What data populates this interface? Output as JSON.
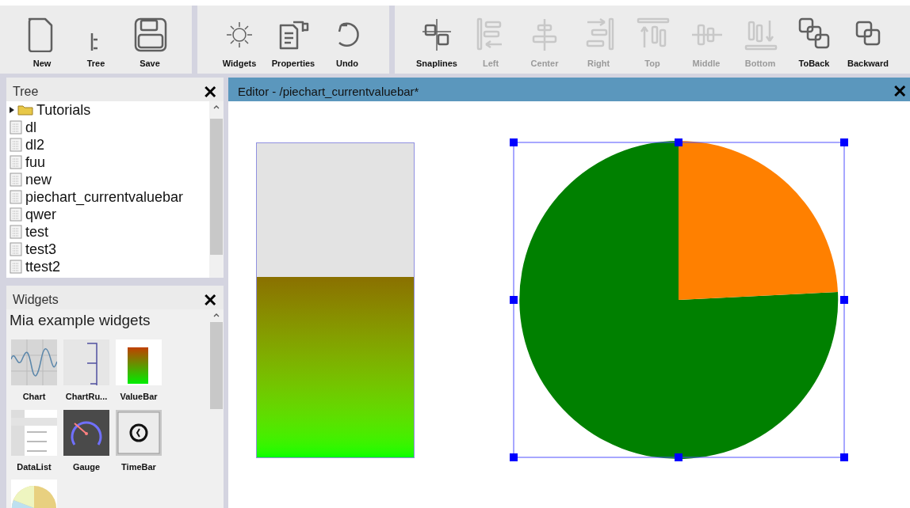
{
  "toolbar": {
    "groups": [
      [
        {
          "label": "New",
          "kind": "new",
          "disabled": false
        },
        {
          "label": "Tree",
          "kind": "tree",
          "disabled": false
        },
        {
          "label": "Save",
          "kind": "save",
          "disabled": false
        }
      ],
      [
        {
          "label": "Widgets",
          "kind": "widgets",
          "disabled": false
        },
        {
          "label": "Properties",
          "kind": "properties",
          "disabled": false
        },
        {
          "label": "Undo",
          "kind": "undo",
          "disabled": false
        }
      ],
      [
        {
          "label": "Snaplines",
          "kind": "snaplines",
          "disabled": false
        },
        {
          "label": "Left",
          "kind": "left",
          "disabled": true
        },
        {
          "label": "Center",
          "kind": "center",
          "disabled": true
        },
        {
          "label": "Right",
          "kind": "right",
          "disabled": true
        },
        {
          "label": "Top",
          "kind": "top",
          "disabled": true
        },
        {
          "label": "Middle",
          "kind": "middle",
          "disabled": true
        },
        {
          "label": "Bottom",
          "kind": "bottom",
          "disabled": true
        },
        {
          "label": "ToBack",
          "kind": "toback",
          "disabled": false
        },
        {
          "label": "Backward",
          "kind": "backward",
          "disabled": false
        }
      ]
    ]
  },
  "tree": {
    "title": "Tree",
    "close": "✕",
    "items": [
      {
        "label": "Tutorials",
        "kind": "folder",
        "expanded": false
      },
      {
        "label": "dl",
        "kind": "file"
      },
      {
        "label": "dl2",
        "kind": "file"
      },
      {
        "label": "fuu",
        "kind": "file"
      },
      {
        "label": "new",
        "kind": "file"
      },
      {
        "label": "piechart_currentvaluebar",
        "kind": "file"
      },
      {
        "label": "qwer",
        "kind": "file"
      },
      {
        "label": "test",
        "kind": "file"
      },
      {
        "label": "test3",
        "kind": "file"
      },
      {
        "label": "ttest2",
        "kind": "file"
      }
    ]
  },
  "widgets": {
    "title": "Widgets",
    "close": "✕",
    "group": "Mia example widgets",
    "items": [
      {
        "label": "Chart",
        "kind": "chart"
      },
      {
        "label": "ChartRu...",
        "kind": "ruler"
      },
      {
        "label": "ValueBar",
        "kind": "valuebar"
      },
      {
        "label": "DataList",
        "kind": "datalist"
      },
      {
        "label": "Gauge",
        "kind": "gauge"
      },
      {
        "label": "TimeBar",
        "kind": "timebar"
      },
      {
        "kind": "pie"
      }
    ]
  },
  "editor": {
    "title": "Editor - /piechart_currentvaluebar*",
    "close": "✕",
    "value_bar": {
      "level": 0.575
    },
    "pie": {
      "selected": true
    }
  }
}
